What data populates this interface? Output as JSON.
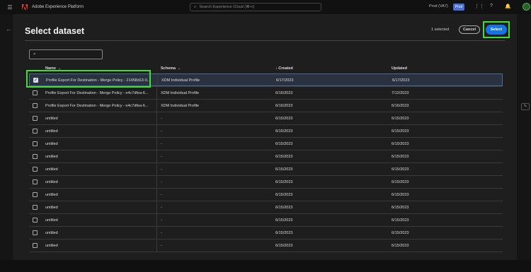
{
  "topbar": {
    "menu_icon": "☰",
    "app_title": "Adobe Experience Platform",
    "search_placeholder": "Search Experience Cloud (⌘+/)",
    "org": "Prod (VA7)",
    "env_badge": "Prod"
  },
  "modal": {
    "title": "Select dataset",
    "selected_count": "1 selected",
    "cancel_label": "Cancel",
    "select_label": "Select"
  },
  "table": {
    "headers": {
      "name": "Name",
      "schema": "Schema",
      "created": "Created",
      "updated": "Updated",
      "sort_arrow": "↓"
    },
    "rows": [
      {
        "name": "Profile Export For Destination - Merge Policy - 21458d13-0...",
        "schema": "XDM Individual Profile",
        "created": "6/17/2023",
        "updated": "6/17/2023",
        "checked": true
      },
      {
        "name": "Profile Export For Destination - Merge Policy - e4c7dfea-6...",
        "schema": "XDM Individual Profile",
        "created": "6/16/2023",
        "updated": "7/12/2023",
        "checked": false
      },
      {
        "name": "Profile Export For Destination - Merge Policy - e4c7dfea-6...",
        "schema": "XDM Individual Profile",
        "created": "6/16/2023",
        "updated": "6/16/2023",
        "checked": false
      },
      {
        "name": "untitled",
        "schema": "-",
        "created": "6/15/2023",
        "updated": "6/15/2023",
        "checked": false
      },
      {
        "name": "untitled",
        "schema": "-",
        "created": "6/15/2023",
        "updated": "6/15/2023",
        "checked": false
      },
      {
        "name": "untitled",
        "schema": "-",
        "created": "6/15/2023",
        "updated": "6/15/2023",
        "checked": false
      },
      {
        "name": "untitled",
        "schema": "-",
        "created": "6/15/2023",
        "updated": "6/15/2023",
        "checked": false
      },
      {
        "name": "untitled",
        "schema": "-",
        "created": "6/15/2023",
        "updated": "6/15/2023",
        "checked": false
      },
      {
        "name": "untitled",
        "schema": "-",
        "created": "6/15/2023",
        "updated": "6/15/2023",
        "checked": false
      },
      {
        "name": "untitled",
        "schema": "-",
        "created": "6/15/2023",
        "updated": "6/15/2023",
        "checked": false
      },
      {
        "name": "untitled",
        "schema": "-",
        "created": "6/15/2023",
        "updated": "6/15/2023",
        "checked": false
      },
      {
        "name": "untitled",
        "schema": "-",
        "created": "6/15/2023",
        "updated": "6/15/2023",
        "checked": false
      },
      {
        "name": "untitled",
        "schema": "-",
        "created": "6/15/2023",
        "updated": "6/15/2023",
        "checked": false
      },
      {
        "name": "untitled",
        "schema": "-",
        "created": "6/15/2023",
        "updated": "6/15/2023",
        "checked": false
      }
    ]
  },
  "colors": {
    "accent": "#1473e6",
    "highlight": "#3fe12c",
    "modal_bg": "#1e1e1e"
  }
}
